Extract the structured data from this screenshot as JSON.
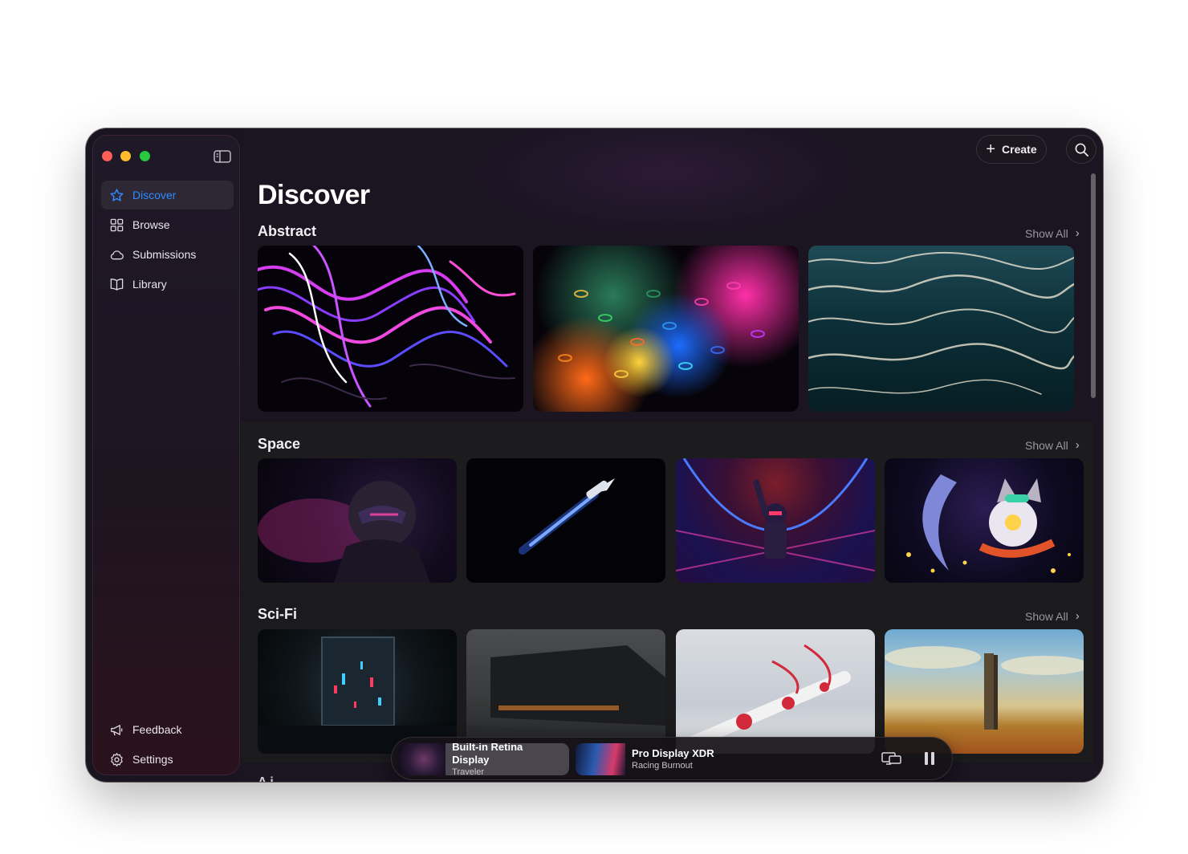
{
  "window": {
    "traffic_lights": [
      "close",
      "minimize",
      "zoom"
    ]
  },
  "sidebar": {
    "items": [
      {
        "label": "Discover",
        "icon": "star-icon",
        "active": true
      },
      {
        "label": "Browse",
        "icon": "grid-icon",
        "active": false
      },
      {
        "label": "Submissions",
        "icon": "cloud-icon",
        "active": false
      },
      {
        "label": "Library",
        "icon": "book-icon",
        "active": false
      }
    ],
    "footer": [
      {
        "label": "Feedback",
        "icon": "megaphone-icon"
      },
      {
        "label": "Settings",
        "icon": "gear-icon"
      }
    ]
  },
  "toolbar": {
    "create_label": "Create"
  },
  "main": {
    "title": "Discover",
    "sections": [
      {
        "title": "Abstract",
        "show_all": "Show All"
      },
      {
        "title": "Space",
        "show_all": "Show All"
      },
      {
        "title": "Sci-Fi",
        "show_all": "Show All"
      }
    ],
    "next_section_peek": "A i"
  },
  "player": {
    "displays": [
      {
        "name": "Built-in Retina Display",
        "wallpaper": "Traveler",
        "selected": true
      },
      {
        "name": "Pro Display XDR",
        "wallpaper": "Racing Burnout",
        "selected": false
      }
    ]
  },
  "colors": {
    "accent": "#2f8bff",
    "window_bg": "#1b1421",
    "close": "#fe5f57",
    "minimize": "#febc2e",
    "zoom": "#28c840"
  }
}
